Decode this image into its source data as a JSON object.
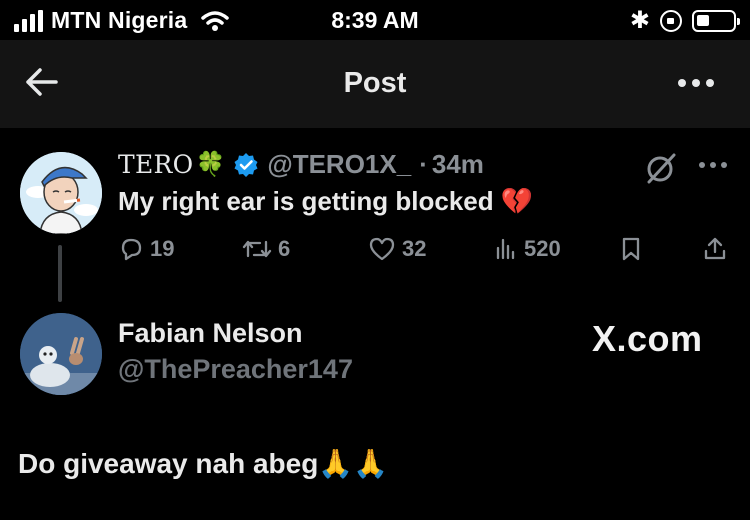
{
  "status_bar": {
    "carrier": "MTN Nigeria",
    "time": "8:39 AM"
  },
  "header": {
    "title": "Post"
  },
  "tweet": {
    "author_name": "TERO",
    "author_emoji": "🍀",
    "handle": "@TERO1X_",
    "separator": "·",
    "time": "34m",
    "text": "My right ear is getting blocked 💔",
    "replies": "19",
    "reposts": "6",
    "likes": "32",
    "views": "520"
  },
  "reply": {
    "author_name": "Fabian Nelson",
    "handle": "@ThePreacher147",
    "text": "Do giveaway nah abeg🙏🙏"
  },
  "watermark": "X.com",
  "colors": {
    "background": "#000000",
    "header_background": "#141414",
    "verified_blue": "#1d9bf0",
    "muted_text": "#8b9096"
  },
  "icons": {
    "back": "arrow-left-icon",
    "more": "more-horizontal-icon",
    "verified": "verified-badge-icon",
    "grok": "grok-icon",
    "reply": "reply-icon",
    "repost": "repost-icon",
    "like": "heart-icon",
    "views": "views-icon",
    "bookmark": "bookmark-icon",
    "share": "share-icon"
  }
}
